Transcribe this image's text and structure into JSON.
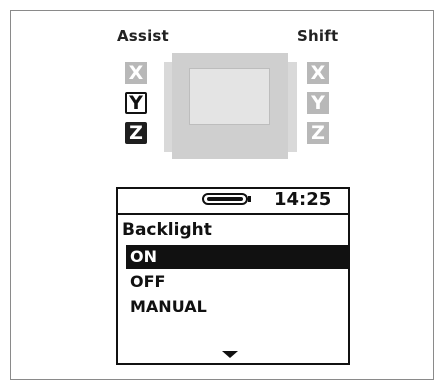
{
  "labels": {
    "assist": "Assist",
    "shift": "Shift"
  },
  "assist_buttons": [
    {
      "letter": "X",
      "state": "inactive"
    },
    {
      "letter": "Y",
      "state": "outlined"
    },
    {
      "letter": "Z",
      "state": "filled"
    }
  ],
  "shift_buttons": [
    {
      "letter": "X",
      "state": "inactive"
    },
    {
      "letter": "Y",
      "state": "inactive"
    },
    {
      "letter": "Z",
      "state": "inactive"
    }
  ],
  "display": {
    "time": "14:25",
    "battery_icon": "battery-full-icon",
    "title": "Backlight",
    "options": [
      "ON",
      "OFF",
      "MANUAL"
    ],
    "selected": "ON",
    "scroll_icon": "down-arrow-icon"
  },
  "colors": {
    "inactive_button": "#b8b8b8",
    "device_body": "#cfcfcf",
    "lcd_ink": "#111111"
  }
}
